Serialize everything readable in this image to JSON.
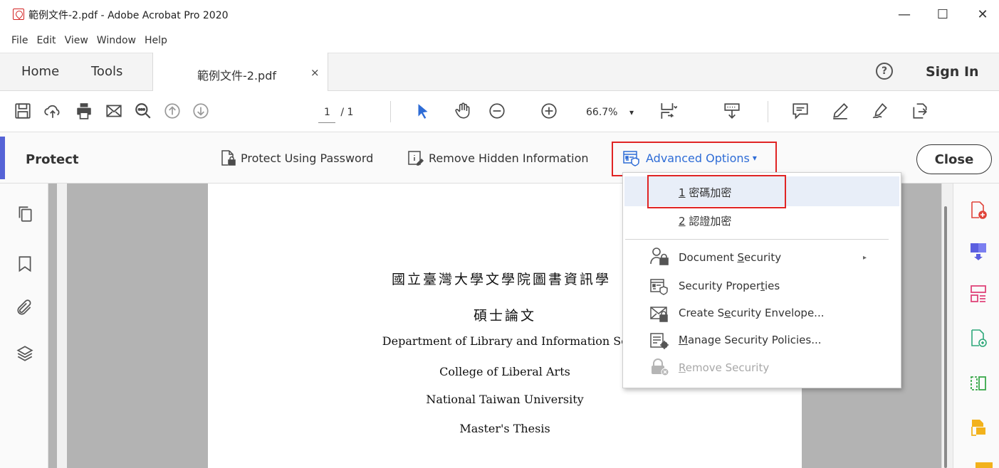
{
  "window": {
    "title": "範例文件-2.pdf - Adobe Acrobat Pro 2020",
    "minimize": "—",
    "maximize": "☐",
    "close": "✕"
  },
  "menubar": [
    "File",
    "Edit",
    "View",
    "Window",
    "Help"
  ],
  "tabs": {
    "home": "Home",
    "tools": "Tools",
    "document": "範例文件-2.pdf",
    "document_close": "×",
    "help": "?",
    "sign_in": "Sign In"
  },
  "toolbar": {
    "page_current": "1",
    "page_total": "/ 1",
    "zoom": "66.7%",
    "zoom_caret": "▾"
  },
  "protect": {
    "title": "Protect",
    "protect_using_password": "Protect Using Password",
    "remove_hidden_information": "Remove Hidden Information",
    "advanced_options": "Advanced Options",
    "advanced_caret": "▾",
    "close": "Close"
  },
  "dropdown": {
    "item1_num": "1",
    "item1_label": " 密碼加密",
    "item2_num": "2",
    "item2_label": " 認證加密",
    "doc_security_pre": "Document ",
    "doc_security_u": "S",
    "doc_security_post": "ecurity",
    "submenu_arrow": "▸",
    "sec_props_pre": "Security Proper",
    "sec_props_u": "t",
    "sec_props_post": "ies",
    "envelope_pre": "Create S",
    "envelope_u": "e",
    "envelope_post": "curity Envelope...",
    "policies_u": "M",
    "policies_post": "anage Security Policies...",
    "remove_u": "R",
    "remove_post": "emove Security"
  },
  "document": {
    "line1": "國立臺灣大學文學院圖書資訊學",
    "line2": "碩士論文",
    "line3": "Department of Library and Information Sc",
    "line4": "College of Liberal Arts",
    "line5": "National Taiwan University",
    "line6": "Master's Thesis"
  },
  "colors": {
    "accent": "#5563d6",
    "link": "#2e6cd6",
    "highlight_box": "#e02424"
  }
}
